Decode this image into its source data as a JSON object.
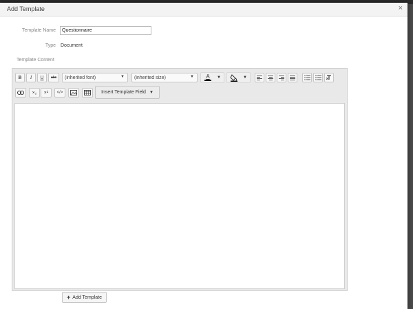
{
  "modal": {
    "title": "Add Template",
    "close_glyph": "×"
  },
  "form": {
    "name_label": "Template Name",
    "name_value": "Questionnaire",
    "type_label": "Type",
    "type_value": "Document",
    "content_label": "Template Content"
  },
  "toolbar": {
    "font_select": "(inherited font)",
    "size_select": "(inherited size)",
    "insert_field_label": "Insert Template Field",
    "bold": "B",
    "italic": "I",
    "underline": "U",
    "strike": "abc",
    "subscript": "×₂",
    "superscript": "×²",
    "code": "</>",
    "font_color_glyph": "A",
    "caret": "▼"
  },
  "footer": {
    "add_label": "Add Template",
    "add_glyph": "+"
  },
  "colors": {
    "modal_bg": "#ffffff",
    "editor_bg": "#e9e9e9",
    "backdrop": "#3a3a3a"
  }
}
